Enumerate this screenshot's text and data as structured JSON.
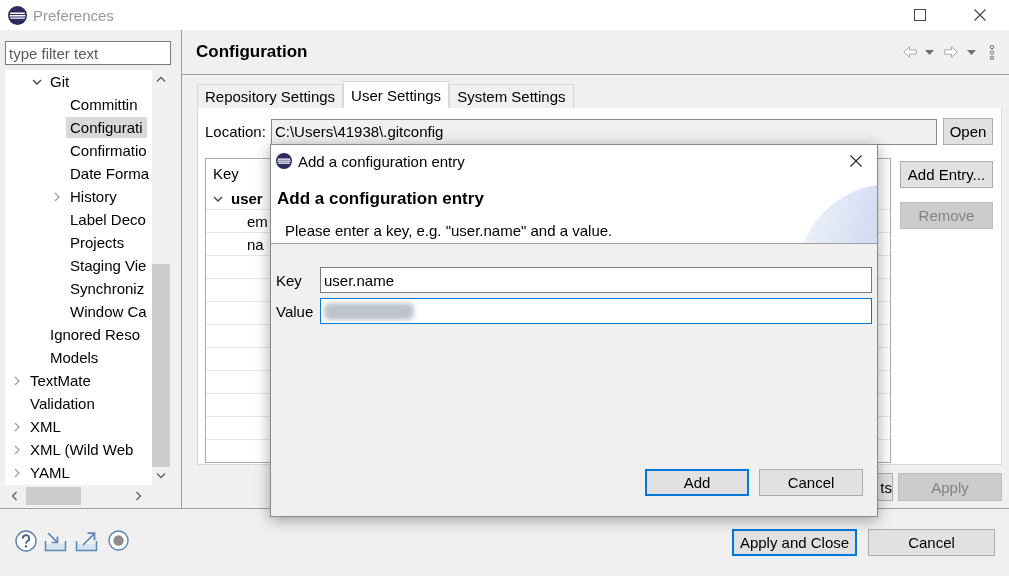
{
  "window": {
    "title": "Preferences",
    "active": false
  },
  "tree": {
    "filter": {
      "placeholder": "type filter text"
    },
    "items": [
      {
        "children": [
          {
            "label": "Git",
            "expanded": true,
            "selected": false,
            "children": [
              {
                "label": "Committin",
                "selected": false
              },
              {
                "label": "Configurati",
                "selected": true
              },
              {
                "label": "Confirmatio",
                "selected": false
              },
              {
                "label": "Date Forma",
                "selected": false
              },
              {
                "label": "History",
                "expanded": false,
                "selected": false
              },
              {
                "label": "Label Deco",
                "selected": false
              },
              {
                "label": "Projects",
                "selected": false
              },
              {
                "label": "Staging Vie",
                "selected": false
              },
              {
                "label": "Synchroniz",
                "selected": false
              },
              {
                "label": "Window Ca",
                "selected": false
              }
            ]
          },
          {
            "label": "Ignored Reso",
            "selected": false
          },
          {
            "label": "Models",
            "selected": false
          }
        ]
      },
      {
        "label": "TextMate",
        "expanded": false,
        "selected": false
      },
      {
        "label": "Validation",
        "selected": false
      },
      {
        "label": "XML",
        "expanded": false,
        "selected": false
      },
      {
        "label": "XML (Wild Web",
        "expanded": false,
        "selected": false
      },
      {
        "label": "YAML",
        "expanded": false,
        "selected": false
      }
    ]
  },
  "page": {
    "title": "Configuration",
    "tabs": [
      {
        "label": "Repository Settings",
        "selected": false
      },
      {
        "label": "User Settings",
        "selected": true
      },
      {
        "label": "System Settings",
        "selected": false
      }
    ],
    "location": {
      "label": "Location:",
      "value": "C:\\Users\\41938\\.gitconfig",
      "button": "Open"
    },
    "table": {
      "columns": [
        "Key"
      ],
      "rows": [
        {
          "label": "user",
          "expanded": true,
          "children": [
            {
              "label": "em"
            },
            {
              "label": "na"
            }
          ]
        }
      ]
    },
    "side_buttons": [
      {
        "label": "Add Entry...",
        "disabled": false
      },
      {
        "label": "Remove",
        "disabled": true
      }
    ],
    "buttons": [
      {
        "label": "ts",
        "disabled": false
      },
      {
        "label": "Apply",
        "disabled": true
      }
    ]
  },
  "footer": {
    "buttons": [
      {
        "label": "Apply and Close",
        "default": true
      },
      {
        "label": "Cancel",
        "default": false
      }
    ]
  },
  "dialog": {
    "title": "Add a configuration entry",
    "heading": "Add a configuration entry",
    "message": "Please enter a key, e.g. \"user.name\" and a value.",
    "fields": [
      {
        "label": "Key",
        "value": "user.name",
        "focused": false
      },
      {
        "label": "Value",
        "focused": true,
        "redacted": true
      }
    ],
    "buttons": [
      {
        "label": "Add",
        "default": true
      },
      {
        "label": "Cancel",
        "default": false
      }
    ]
  }
}
